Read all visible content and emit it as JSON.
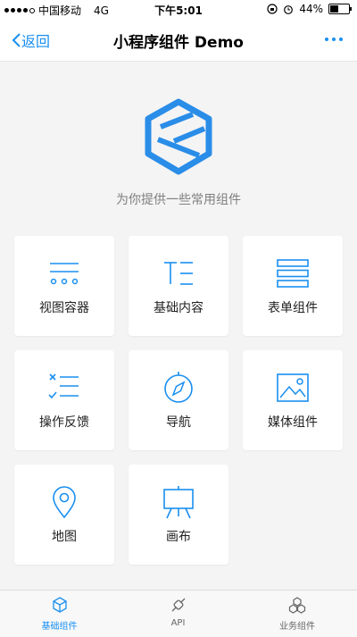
{
  "status": {
    "carrier": "中国移动",
    "network": "4G",
    "time": "下午5:01",
    "battery": "44%",
    "battery_level": 0.44
  },
  "nav": {
    "back_label": "返回",
    "title": "小程序组件 Demo"
  },
  "hero": {
    "subtitle": "为你提供一些常用组件",
    "icon": "hexagon-logo-icon"
  },
  "components": [
    {
      "label": "视图容器",
      "icon": "view-container-icon"
    },
    {
      "label": "基础内容",
      "icon": "basic-content-icon"
    },
    {
      "label": "表单组件",
      "icon": "form-icon"
    },
    {
      "label": "操作反馈",
      "icon": "feedback-icon"
    },
    {
      "label": "导航",
      "icon": "compass-icon"
    },
    {
      "label": "媒体组件",
      "icon": "image-icon"
    },
    {
      "label": "地图",
      "icon": "map-pin-icon"
    },
    {
      "label": "画布",
      "icon": "easel-icon"
    }
  ],
  "tabs": [
    {
      "label": "基础组件",
      "icon": "cube-icon",
      "active": true
    },
    {
      "label": "API",
      "icon": "plug-icon",
      "active": false
    },
    {
      "label": "业务组件",
      "icon": "cubes-icon",
      "active": false
    }
  ],
  "colors": {
    "accent": "#1a8ff0",
    "background": "#f4f4f4"
  }
}
